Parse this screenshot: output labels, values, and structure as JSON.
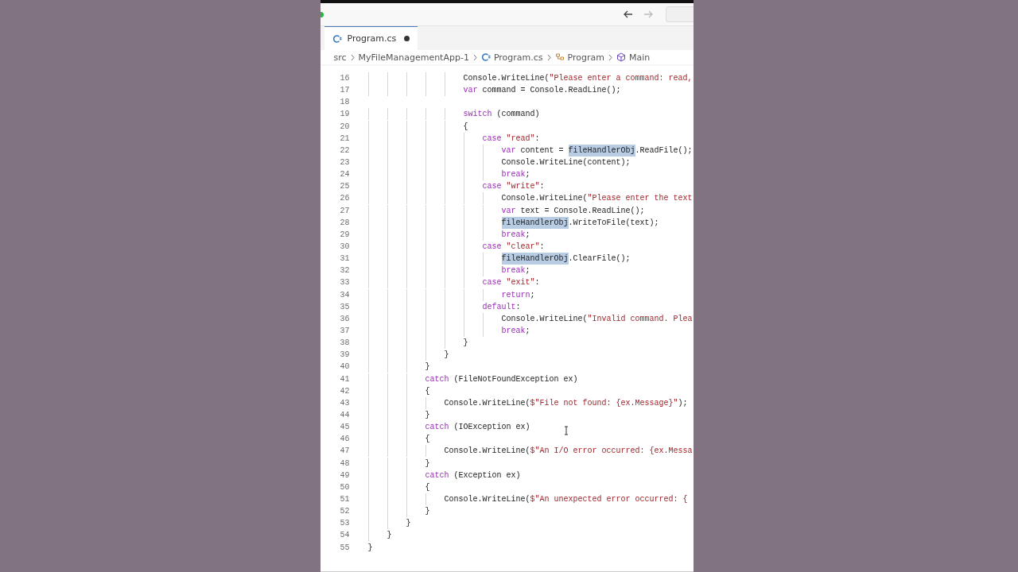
{
  "title_bar": {
    "back_disabled": false,
    "forward_disabled": true
  },
  "tabs": [
    {
      "label": "Program.cs",
      "selected": true,
      "modified": true
    }
  ],
  "breadcrumb": [
    {
      "label": "src",
      "kind": "folder"
    },
    {
      "label": "MyFileManagementApp-1",
      "kind": "folder"
    },
    {
      "label": "Program.cs",
      "kind": "csharp"
    },
    {
      "label": "Program",
      "kind": "class"
    },
    {
      "label": "Main",
      "kind": "method"
    }
  ],
  "editor": {
    "lines": [
      {
        "number": "16",
        "segments": [
          {
            "kind": "plain",
            "text": "                    Console.WriteLine("
          },
          {
            "kind": "str",
            "text": "\"Please enter a command: read,"
          }
        ]
      },
      {
        "number": "17",
        "segments": [
          {
            "kind": "kw",
            "text": "                    var"
          },
          {
            "kind": "plain",
            "text": " command = Console.ReadLine();"
          }
        ]
      },
      {
        "number": "18"
      },
      {
        "number": "19",
        "segments": [
          {
            "kind": "kw",
            "text": "                    switch"
          },
          {
            "kind": "plain",
            "text": " (command)"
          }
        ]
      },
      {
        "number": "20",
        "segments": [
          {
            "kind": "plain",
            "text": "                    {"
          }
        ]
      },
      {
        "number": "21",
        "segments": [
          {
            "kind": "kw",
            "text": "                        case"
          },
          {
            "kind": "str",
            "text": " \"read\""
          },
          {
            "kind": "plain",
            "text": ":"
          }
        ]
      },
      {
        "number": "22",
        "segments": [
          {
            "kind": "kw",
            "text": "                            var"
          },
          {
            "kind": "plain",
            "text": " content = "
          },
          {
            "kind": "match",
            "text": "fileHandlerObj"
          },
          {
            "kind": "plain",
            "text": ".ReadFile();"
          }
        ]
      },
      {
        "number": "23",
        "segments": [
          {
            "kind": "plain",
            "text": "                            Console.WriteLine(content);"
          }
        ]
      },
      {
        "number": "24",
        "segments": [
          {
            "kind": "kw",
            "text": "                            break"
          },
          {
            "kind": "plain",
            "text": ";"
          }
        ]
      },
      {
        "number": "25",
        "segments": [
          {
            "kind": "kw",
            "text": "                        case"
          },
          {
            "kind": "str",
            "text": " \"write\""
          },
          {
            "kind": "plain",
            "text": ":"
          }
        ]
      },
      {
        "number": "26",
        "segments": [
          {
            "kind": "plain",
            "text": "                            Console.WriteLine("
          },
          {
            "kind": "str",
            "text": "\"Please enter the text"
          }
        ]
      },
      {
        "number": "27",
        "segments": [
          {
            "kind": "kw",
            "text": "                            var"
          },
          {
            "kind": "plain",
            "text": " text = Console.ReadLine();"
          }
        ]
      },
      {
        "number": "28",
        "segments": [
          {
            "kind": "match",
            "text": "                            fileHandlerObj"
          },
          {
            "kind": "plain",
            "text": ".WriteToFile(text);"
          }
        ]
      },
      {
        "number": "29",
        "segments": [
          {
            "kind": "kw",
            "text": "                            break"
          },
          {
            "kind": "plain",
            "text": ";"
          }
        ]
      },
      {
        "number": "30",
        "segments": [
          {
            "kind": "kw",
            "text": "                        case"
          },
          {
            "kind": "str",
            "text": " \"clear\""
          },
          {
            "kind": "plain",
            "text": ":"
          }
        ]
      },
      {
        "number": "31",
        "segments": [
          {
            "kind": "match",
            "text": "                            fileHandlerObj"
          },
          {
            "kind": "plain",
            "text": ".ClearFile();"
          }
        ]
      },
      {
        "number": "32",
        "segments": [
          {
            "kind": "kw",
            "text": "                            break"
          },
          {
            "kind": "plain",
            "text": ";"
          }
        ]
      },
      {
        "number": "33",
        "segments": [
          {
            "kind": "kw",
            "text": "                        case"
          },
          {
            "kind": "str",
            "text": " \"exit\""
          },
          {
            "kind": "plain",
            "text": ":"
          }
        ]
      },
      {
        "number": "34",
        "segments": [
          {
            "kind": "kw",
            "text": "                            return"
          },
          {
            "kind": "plain",
            "text": ";"
          }
        ]
      },
      {
        "number": "35",
        "segments": [
          {
            "kind": "kw",
            "text": "                        default"
          },
          {
            "kind": "plain",
            "text": ":"
          }
        ]
      },
      {
        "number": "36",
        "segments": [
          {
            "kind": "plain",
            "text": "                            Console.WriteLine("
          },
          {
            "kind": "str",
            "text": "\"Invalid command. Plea"
          }
        ]
      },
      {
        "number": "37",
        "segments": [
          {
            "kind": "kw",
            "text": "                            break"
          },
          {
            "kind": "plain",
            "text": ";"
          }
        ]
      },
      {
        "number": "38",
        "segments": [
          {
            "kind": "plain",
            "text": "                    }"
          }
        ]
      },
      {
        "number": "39",
        "segments": [
          {
            "kind": "plain",
            "text": "                }"
          }
        ]
      },
      {
        "number": "40",
        "segments": [
          {
            "kind": "plain",
            "text": "            }"
          }
        ]
      },
      {
        "number": "41",
        "segments": [
          {
            "kind": "kw",
            "text": "            catch"
          },
          {
            "kind": "plain",
            "text": " (FileNotFoundException ex)"
          }
        ]
      },
      {
        "number": "42",
        "segments": [
          {
            "kind": "plain",
            "text": "            {"
          }
        ]
      },
      {
        "number": "43",
        "segments": [
          {
            "kind": "plain",
            "text": "                Console.WriteLine("
          },
          {
            "kind": "str",
            "text": "$\"File not found: {ex.Message}\""
          },
          {
            "kind": "plain",
            "text": ");"
          }
        ]
      },
      {
        "number": "44",
        "segments": [
          {
            "kind": "plain",
            "text": "            }"
          }
        ]
      },
      {
        "number": "45",
        "segments": [
          {
            "kind": "kw",
            "text": "            catch"
          },
          {
            "kind": "plain",
            "text": " (IOException ex)"
          }
        ]
      },
      {
        "number": "46",
        "segments": [
          {
            "kind": "plain",
            "text": "            {"
          }
        ]
      },
      {
        "number": "47",
        "segments": [
          {
            "kind": "plain",
            "text": "                Console.WriteLine("
          },
          {
            "kind": "str",
            "text": "$\"An I/O error occurred: {ex.Messa"
          }
        ]
      },
      {
        "number": "48",
        "segments": [
          {
            "kind": "plain",
            "text": "            }"
          }
        ]
      },
      {
        "number": "49",
        "segments": [
          {
            "kind": "kw",
            "text": "            catch"
          },
          {
            "kind": "plain",
            "text": " (Exception ex)"
          }
        ]
      },
      {
        "number": "50",
        "segments": [
          {
            "kind": "plain",
            "text": "            {"
          }
        ]
      },
      {
        "number": "51",
        "segments": [
          {
            "kind": "plain",
            "text": "                Console.WriteLine("
          },
          {
            "kind": "str",
            "text": "$\"An unexpected error occurred: {"
          }
        ]
      },
      {
        "number": "52",
        "segments": [
          {
            "kind": "plain",
            "text": "            }"
          }
        ]
      },
      {
        "number": "53",
        "segments": [
          {
            "kind": "plain",
            "text": "        }"
          }
        ]
      },
      {
        "number": "54",
        "segments": [
          {
            "kind": "plain",
            "text": "    }"
          }
        ]
      },
      {
        "number": "55",
        "segments": [
          {
            "kind": "plain",
            "text": "}"
          }
        ]
      }
    ]
  }
}
